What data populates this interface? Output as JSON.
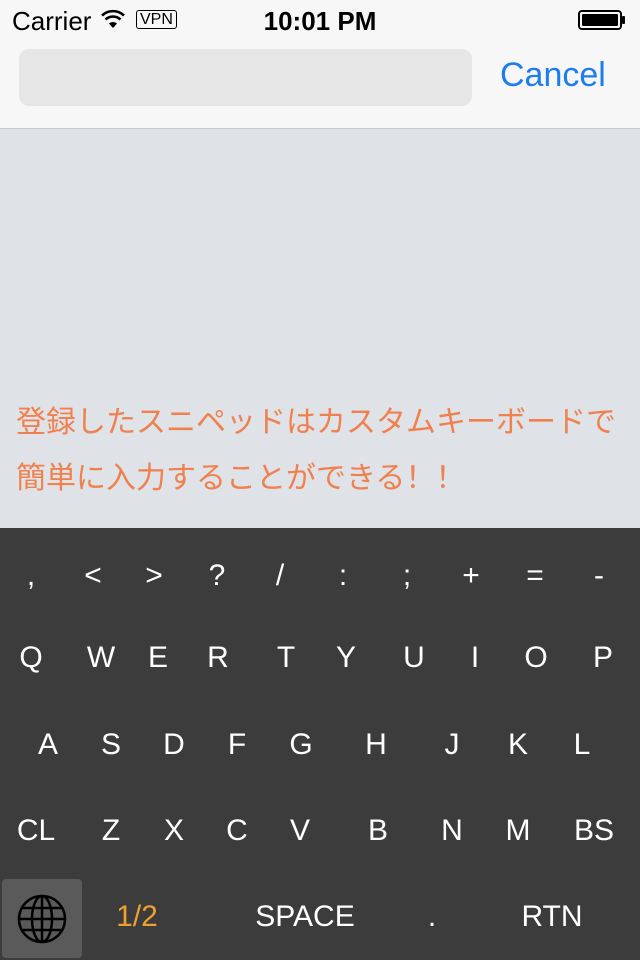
{
  "status_bar": {
    "carrier": "Carrier",
    "vpn": "VPN",
    "time": "10:01 PM"
  },
  "nav": {
    "search_value": "",
    "cancel_label": "Cancel"
  },
  "content": {
    "hint": "登録したスニペッドはカスタムキーボードで\n簡単に入力することができる！！"
  },
  "keyboard": {
    "rows": [
      [
        ",",
        "<",
        ">",
        "?",
        "/",
        ":",
        ";",
        "+",
        "=",
        "-"
      ],
      [
        "Q",
        "W",
        "E",
        "R",
        "T",
        "Y",
        "U",
        "I",
        "O",
        "P"
      ],
      [
        "A",
        "S",
        "D",
        "F",
        "G",
        "H",
        "J",
        "K",
        "L"
      ],
      [
        "CL",
        "Z",
        "X",
        "C",
        "V",
        "B",
        "N",
        "M",
        "BS"
      ]
    ],
    "bottom": {
      "page": "1/2",
      "space": "SPACE",
      "period": ".",
      "return": "RTN"
    }
  },
  "colors": {
    "accent": "#1c7cf0",
    "hint": "#f0804e",
    "page_key": "#f0a02e",
    "keyboard_bg": "#3c3c3c"
  },
  "icons": {
    "globe": "globe-icon",
    "wifi": "wifi-icon",
    "battery": "battery-icon"
  }
}
